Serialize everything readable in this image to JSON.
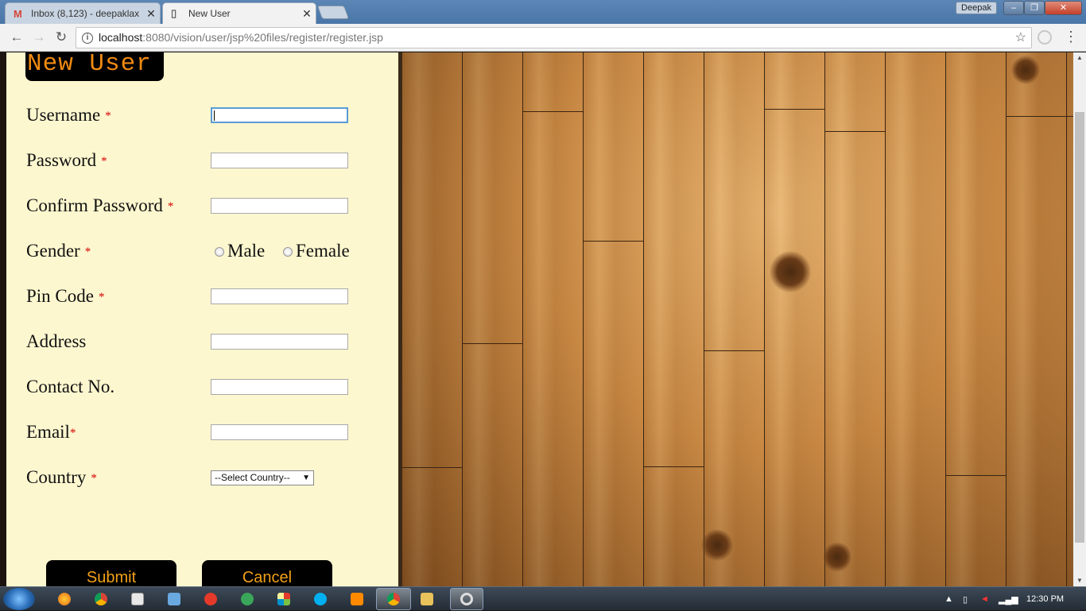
{
  "browser": {
    "tabs": [
      {
        "icon": "M",
        "label": "Inbox (8,123) - deepaklax",
        "close": "✕",
        "active": false
      },
      {
        "icon": "▯",
        "label": "New User",
        "close": "✕",
        "active": true
      }
    ],
    "profile_name": "Deepak",
    "url_host": "localhost",
    "url_rest": ":8080/vision/user/jsp%20files/register/register.jsp",
    "icons": {
      "back": "←",
      "forward": "→",
      "reload": "↻",
      "info": "i",
      "star": "☆",
      "menu": "⋮"
    }
  },
  "form": {
    "heading": "New User",
    "required_mark": "*",
    "fields": [
      {
        "label": "Username",
        "required": true
      },
      {
        "label": "Password",
        "required": true
      },
      {
        "label": "Confirm Password",
        "required": true
      },
      {
        "label": "Gender",
        "required": true
      },
      {
        "label": "Pin Code",
        "required": true
      },
      {
        "label": "Address",
        "required": false
      },
      {
        "label": "Contact No.",
        "required": false
      },
      {
        "label": "Email",
        "required": true
      },
      {
        "label": "Country",
        "required": true
      }
    ],
    "gender_options": [
      "Male",
      "Female"
    ],
    "country_select_value": "--Select Country--",
    "submit_label": "Submit",
    "cancel_label": "Cancel"
  },
  "taskbar": {
    "clock": "12:30 PM"
  },
  "colors": {
    "panel_bg": "#fdf7cf",
    "heading_text": "#f08a12",
    "required": "#d40000",
    "button_text": "#f2a019"
  }
}
